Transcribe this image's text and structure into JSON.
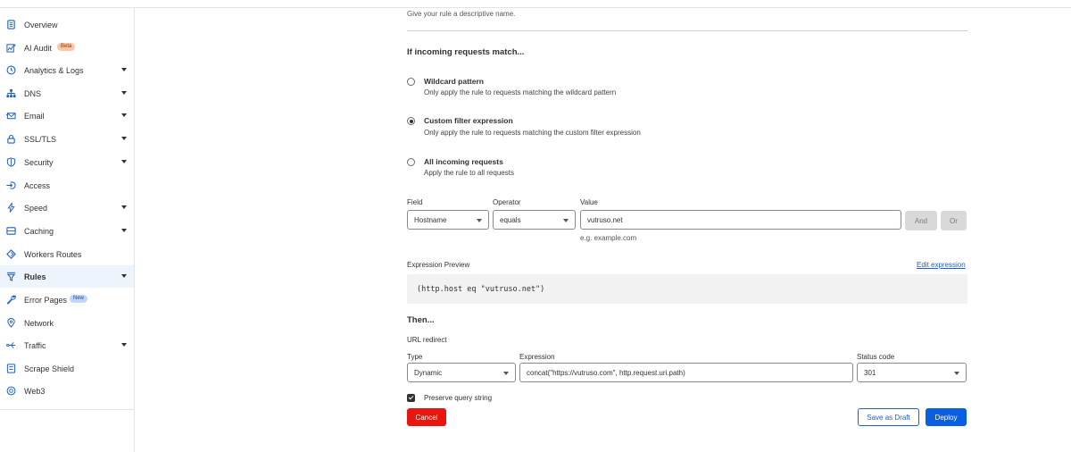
{
  "sidebar": {
    "items": [
      {
        "label": "Overview",
        "icon": "document-icon"
      },
      {
        "label": "AI Audit",
        "icon": "chart-sparkle-icon",
        "badge": "Beta"
      },
      {
        "label": "Analytics & Logs",
        "icon": "clock-chart-icon",
        "expandable": true
      },
      {
        "label": "DNS",
        "icon": "network-tree-icon",
        "expandable": true
      },
      {
        "label": "Email",
        "icon": "envelope-icon",
        "expandable": true
      },
      {
        "label": "SSL/TLS",
        "icon": "lock-icon",
        "expandable": true
      },
      {
        "label": "Security",
        "icon": "shield-icon",
        "expandable": true
      },
      {
        "label": "Access",
        "icon": "sign-in-icon"
      },
      {
        "label": "Speed",
        "icon": "lightning-icon",
        "expandable": true
      },
      {
        "label": "Caching",
        "icon": "server-icon",
        "expandable": true
      },
      {
        "label": "Workers Routes",
        "icon": "diamond-icon"
      },
      {
        "label": "Rules",
        "icon": "funnel-icon",
        "expandable": true,
        "active": true
      },
      {
        "label": "Error Pages",
        "icon": "wrench-icon",
        "badge": "New"
      },
      {
        "label": "Network",
        "icon": "location-pin-icon"
      },
      {
        "label": "Traffic",
        "icon": "branch-icon",
        "expandable": true
      },
      {
        "label": "Scrape Shield",
        "icon": "page-icon"
      },
      {
        "label": "Web3",
        "icon": "globe-icon"
      }
    ]
  },
  "form": {
    "name_hint": "Give your rule a descriptive name.",
    "match_heading": "If incoming requests match...",
    "options": [
      {
        "title": "Wildcard pattern",
        "desc": "Only apply the rule to requests matching the wildcard pattern",
        "checked": false
      },
      {
        "title": "Custom filter expression",
        "desc": "Only apply the rule to requests matching the custom filter expression",
        "checked": true
      },
      {
        "title": "All incoming requests",
        "desc": "Apply the rule to all requests",
        "checked": false
      }
    ],
    "field_label": "Field",
    "operator_label": "Operator",
    "value_label": "Value",
    "field_value": "Hostname",
    "operator_value": "equals",
    "value_value": "vutruso.net",
    "value_example": "e.g. example.com",
    "and_label": "And",
    "or_label": "Or",
    "preview_label": "Expression Preview",
    "edit_expression": "Edit expression",
    "preview_code": "(http.host eq \"vutruso.net\")",
    "then_heading": "Then...",
    "redirect_label": "URL redirect",
    "type_label": "Type",
    "type_value": "Dynamic",
    "expression_label": "Expression",
    "expression_value": "concat(\"https://vutruso.com\", http.request.uri.path)",
    "status_label": "Status code",
    "status_value": "301",
    "preserve_label": "Preserve query string",
    "cancel_label": "Cancel",
    "save_draft_label": "Save as Draft",
    "deploy_label": "Deploy"
  },
  "colors": {
    "accent": "#1f5fc4",
    "danger": "#e7170f",
    "primary_button": "#0a5ee0"
  }
}
